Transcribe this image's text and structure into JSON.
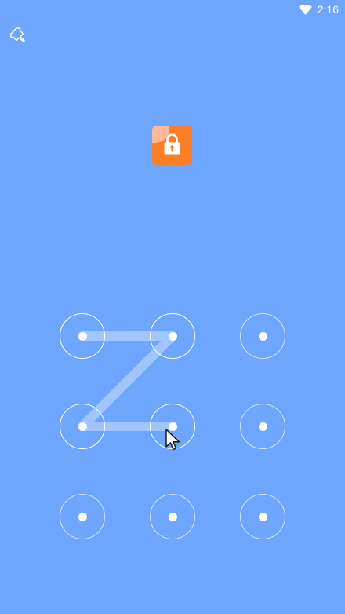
{
  "status_bar": {
    "time": "2:16",
    "wifi_icon": "wifi-icon"
  },
  "toolbar": {
    "pin_icon": "pin-icon"
  },
  "app_icon": {
    "icon": "lock-icon",
    "background_color": "#fb7f26",
    "fold_color": "#fdb99a"
  },
  "pattern_lock": {
    "background_color": "#6fa6fd",
    "line_color": "rgba(255,255,255,0.35)",
    "nodes": [
      {
        "row": 1,
        "col": 1,
        "active": true
      },
      {
        "row": 1,
        "col": 2,
        "active": true
      },
      {
        "row": 1,
        "col": 3,
        "active": false
      },
      {
        "row": 2,
        "col": 1,
        "active": true
      },
      {
        "row": 2,
        "col": 2,
        "active": true
      },
      {
        "row": 2,
        "col": 3,
        "active": false
      },
      {
        "row": 3,
        "col": 1,
        "active": false
      },
      {
        "row": 3,
        "col": 2,
        "active": false
      },
      {
        "row": 3,
        "col": 3,
        "active": false
      }
    ],
    "drawn_sequence": [
      1,
      2,
      4,
      5
    ]
  }
}
